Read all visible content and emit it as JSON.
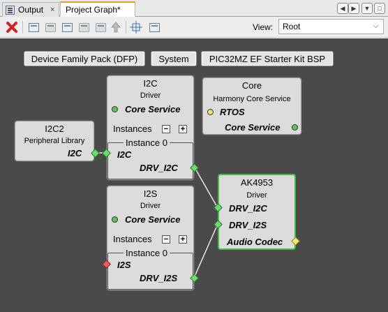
{
  "tabs": {
    "output_label": "Output",
    "output_close": "×",
    "graph_label": "Project Graph*"
  },
  "nav": {
    "prev": "◀",
    "next": "▶",
    "menu": "▼",
    "restore": "□"
  },
  "toolbar": {
    "view_label": "View:",
    "view_value": "Root",
    "chevron": "⌵"
  },
  "canvas": {
    "buttons": {
      "dfp": "Device Family Pack (DFP)",
      "system": "System",
      "bsp": "PIC32MZ EF Starter Kit BSP"
    },
    "i2c_driver": {
      "title": "I2C",
      "subtitle": "Driver",
      "service": "Core Service",
      "instances": "Instances",
      "minus": "−",
      "plus": "+",
      "instance": "Instance 0",
      "in_port": "I2C",
      "out_port": "DRV_I2C"
    },
    "core": {
      "title": "Core",
      "subtitle": "Harmony Core Service",
      "rtos": "RTOS",
      "service": "Core Service"
    },
    "i2c2": {
      "title": "I2C2",
      "subtitle": "Peripheral Library",
      "port": "I2C"
    },
    "i2s_driver": {
      "title": "I2S",
      "subtitle": "Driver",
      "service": "Core Service",
      "instances": "Instances",
      "minus": "−",
      "plus": "+",
      "instance": "Instance 0",
      "in_port": "I2S",
      "out_port": "DRV_I2S"
    },
    "ak4953": {
      "title": "AK4953",
      "subtitle": "Driver",
      "port_i2c": "DRV_I2C",
      "port_i2s": "DRV_I2S",
      "audio": "Audio Codec"
    }
  },
  "colors": {
    "canvas_bg": "#4a4a4a",
    "node_bg": "#dcdcdc",
    "selected_border": "#3ec03e",
    "port_green": "#6fdc6f",
    "port_yellow": "#f4ec7a",
    "port_red": "#e86060",
    "tab_accent": "#e89b30",
    "delete_red": "#d42020"
  }
}
